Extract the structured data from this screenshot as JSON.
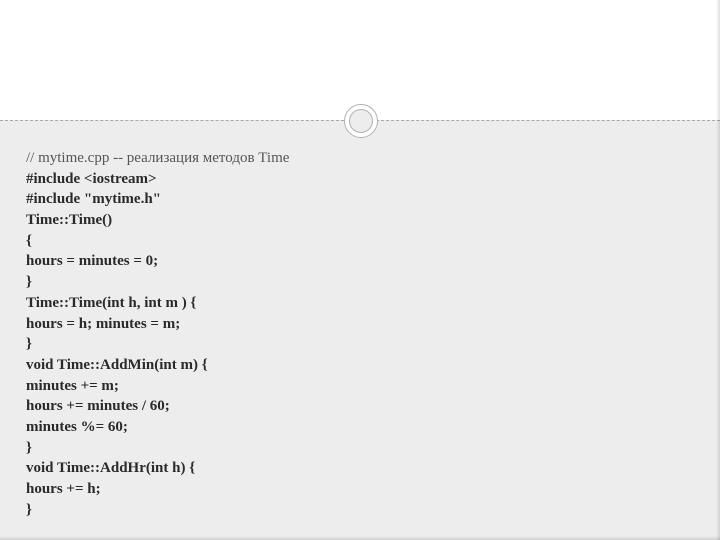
{
  "code": {
    "comment": "// mytime.cpp -- реализация методов Time",
    "lines": [
      "#include <iostream>",
      "#include \"mytime.h\"",
      "Time::Time()",
      "{",
      "hours = minutes = 0;",
      "}",
      "Time::Time(int h, int m ) {",
      "hours = h; minutes = m;",
      "}",
      "void Time::AddMin(int m) {",
      "minutes += m;",
      "hours += minutes / 60;",
      "minutes %= 60;",
      "}",
      "void Time::AddHr(int h) {",
      "hours += h;",
      "}"
    ]
  }
}
